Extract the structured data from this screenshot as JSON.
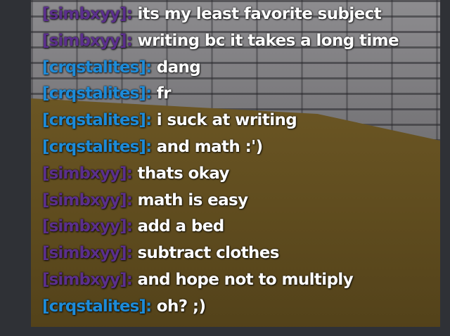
{
  "colors": {
    "simbxyy": "#5b2f8c",
    "crqstalites": "#1d8bd8"
  },
  "chat": {
    "messages": [
      {
        "user": "[simbxyy]:",
        "user_key": "simbxyy",
        "text": "its my least favorite subject"
      },
      {
        "user": "[simbxyy]:",
        "user_key": "simbxyy",
        "text": "writing bc it takes a long time"
      },
      {
        "user": "[crqstalites]:",
        "user_key": "crqstalites",
        "text": "dang"
      },
      {
        "user": "[crqstalites]:",
        "user_key": "crqstalites",
        "text": "fr"
      },
      {
        "user": "[crqstalites]:",
        "user_key": "crqstalites",
        "text": "i suck at writing"
      },
      {
        "user": "[crqstalites]:",
        "user_key": "crqstalites",
        "text": "and math :')"
      },
      {
        "user": "[simbxyy]:",
        "user_key": "simbxyy",
        "text": "thats okay"
      },
      {
        "user": "[simbxyy]:",
        "user_key": "simbxyy",
        "text": "math is easy"
      },
      {
        "user": "[simbxyy]:",
        "user_key": "simbxyy",
        "text": "add a bed"
      },
      {
        "user": "[simbxyy]:",
        "user_key": "simbxyy",
        "text": "subtract clothes"
      },
      {
        "user": "[simbxyy]:",
        "user_key": "simbxyy",
        "text": "and hope not to multiply"
      },
      {
        "user": "[crqstalites]:",
        "user_key": "crqstalites",
        "text": "oh? ;)"
      }
    ]
  }
}
